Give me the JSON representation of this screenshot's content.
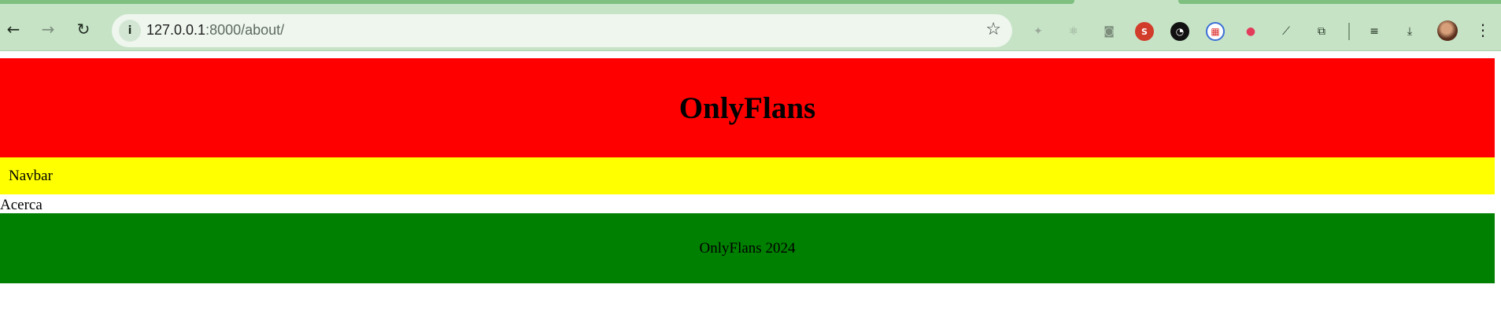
{
  "browser": {
    "url_host": "127.0.0.1",
    "url_path": ":8000/about/",
    "extensions": [
      "sparkle-icon",
      "react-icon",
      "camera-icon",
      "seo-icon",
      "dark-circle-icon",
      "grid-icon",
      "strawberry-icon",
      "eyedropper-icon",
      "puzzle-icon",
      "reading-list-icon",
      "download-icon"
    ],
    "colors": {
      "frame": "#c6e3c6",
      "tab": "#7fbf80",
      "omnibox": "#eef6ee"
    }
  },
  "page": {
    "header_title": "OnlyFlans",
    "navbar_label": "Navbar",
    "content_text": "Acerca",
    "footer_text": "OnlyFlans 2024",
    "colors": {
      "header": "#ff0000",
      "navbar": "#ffff00",
      "footer": "#008000"
    }
  }
}
